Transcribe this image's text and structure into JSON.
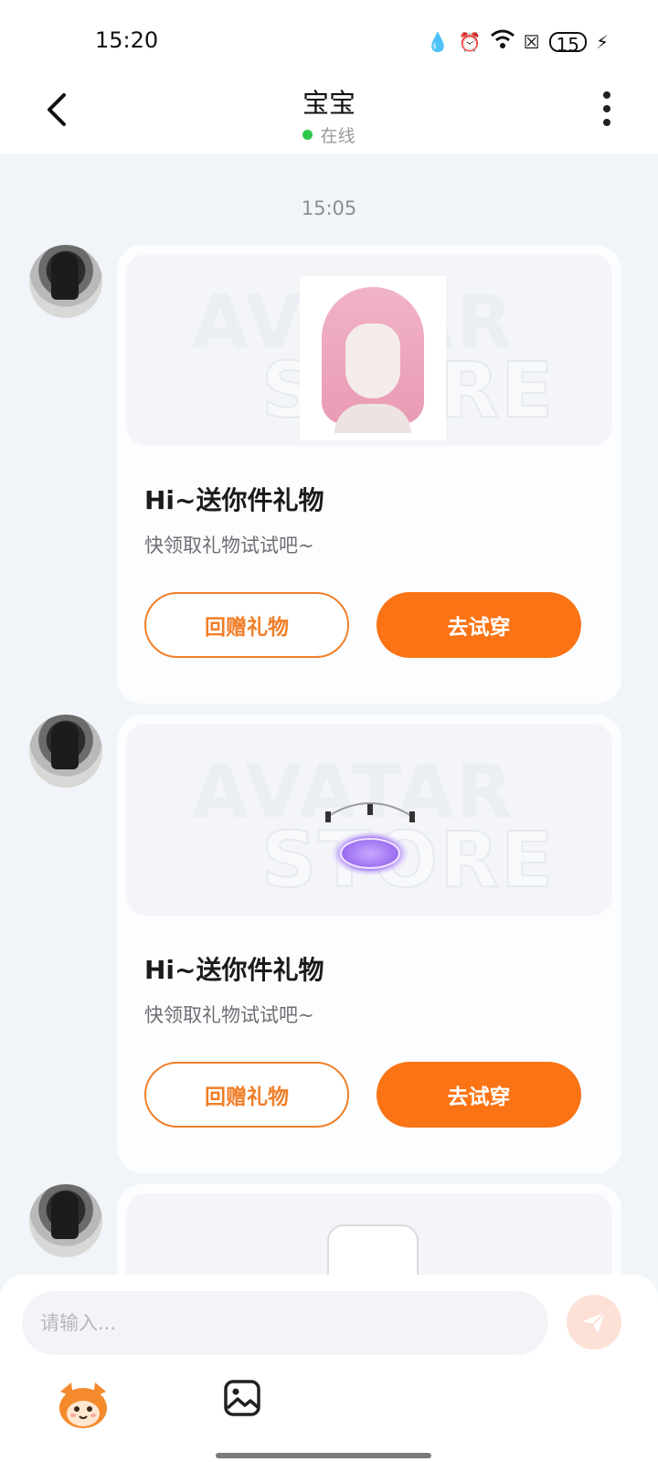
{
  "status_bar": {
    "time": "15:20",
    "battery": "15"
  },
  "header": {
    "title": "宝宝",
    "status": "在线",
    "status_color": "#2fc84a"
  },
  "chat": {
    "timestamp": "15:05",
    "watermark_line1": "AVATAR",
    "watermark_line2": "STORE",
    "messages": [
      {
        "title": "Hi~送你件礼物",
        "subtitle": "快领取礼物试试吧~",
        "secondary_button": "回赠礼物",
        "primary_button": "去试穿",
        "item": "pink-hair-icon"
      },
      {
        "title": "Hi~送你件礼物",
        "subtitle": "快领取礼物试试吧~",
        "secondary_button": "回赠礼物",
        "primary_button": "去试穿",
        "item": "purple-halo-icon"
      },
      {
        "item": "shirt-icon"
      }
    ]
  },
  "input_bar": {
    "placeholder": "请输入...",
    "accent_color": "#fa7314"
  }
}
